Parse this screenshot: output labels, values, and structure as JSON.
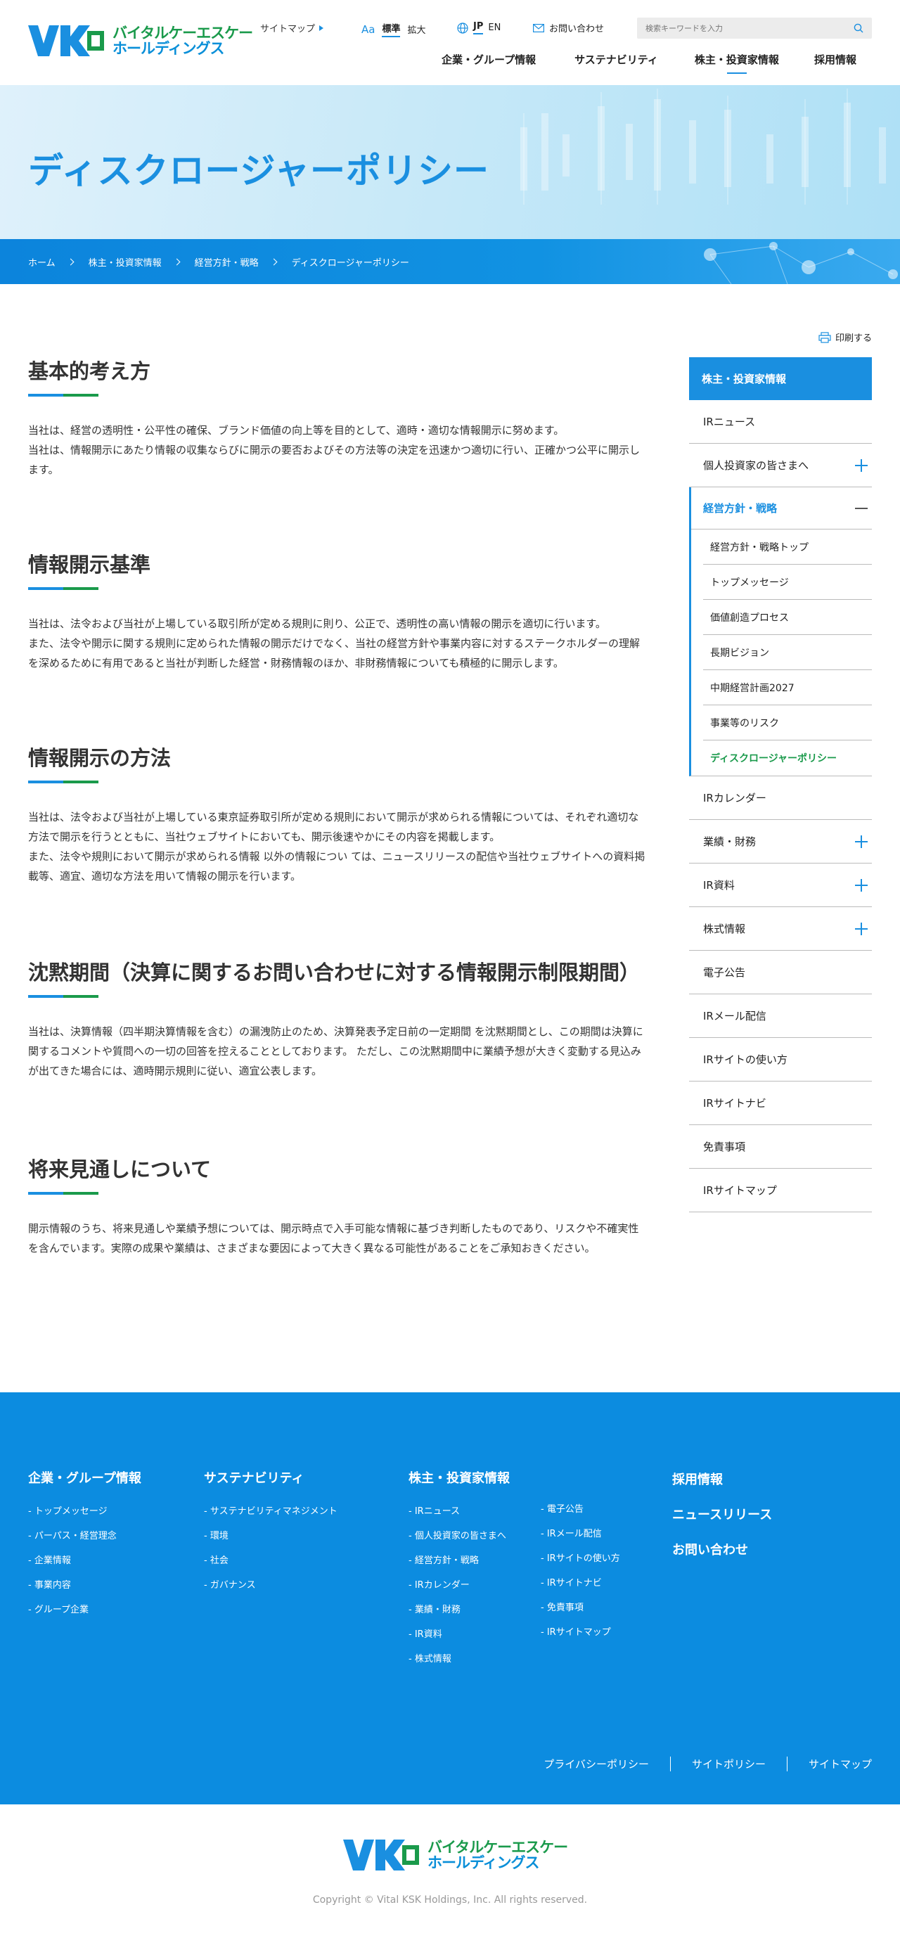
{
  "header": {
    "logo_line1": "バイタルケーエスケー",
    "logo_line2": "ホールディングス",
    "sitemap": "サイトマップ",
    "font_size_icon": "Aa",
    "font_standard": "標準",
    "font_large": "拡大",
    "lang_jp": "JP",
    "lang_en": "EN",
    "contact": "お問い合わせ",
    "search_placeholder": "検索キーワードを入力",
    "nav": [
      {
        "label": "企業・グループ情報"
      },
      {
        "label": "サステナビリティ"
      },
      {
        "label": "株主・投資家情報"
      },
      {
        "label": "採用情報"
      }
    ]
  },
  "hero": {
    "title": "ディスクロージャーポリシー"
  },
  "breadcrumb": [
    "ホーム",
    "株主・投資家情報",
    "経営方針・戦略",
    "ディスクロージャーポリシー"
  ],
  "print": "印刷する",
  "sections": [
    {
      "title": "基本的考え方",
      "body": "当社は、経営の透明性・公平性の確保、ブランド価値の向上等を目的として、適時・適切な情報開示に努めます。\n当社は、情報開示にあたり情報の収集ならびに開示の要否およびその方法等の決定を迅速かつ適切に行い、正確かつ公平に開示します。"
    },
    {
      "title": "情報開示基準",
      "body": "当社は、法令および当社が上場している取引所が定める規則に則り、公正で、透明性の高い情報の開示を適切に行います。\nまた、法令や開示に関する規則に定められた情報の開示だけでなく、当社の経営方針や事業内容に対するステークホルダーの理解を深めるために有用であると当社が判断した経営・財務情報のほか、非財務情報についても積極的に開示します。"
    },
    {
      "title": "情報開示の方法",
      "body": "当社は、法令および当社が上場している東京証券取引所が定める規則において開示が求められる情報については、それぞれ適切な方法で開示を行うとともに、当社ウェブサイトにおいても、開示後速やかにその内容を掲載します。\nまた、法令や規則において開示が求められる情報 以外の情報につい ては、ニュースリリースの配信や当社ウェブサイトへの資料掲載等、適宜、適切な方法を用いて情報の開示を行います。"
    },
    {
      "title": "沈黙期間（決算に関するお問い合わせに対する情報開示制限期間）",
      "body": "当社は、決算情報（四半期決算情報を含む）の漏洩防止のため、決算発表予定日前の一定期間 を沈黙期間とし、この期間は決算に関するコメントや質問への一切の回答を控えることとしております。 ただし、この沈黙期間中に業績予想が大きく変動する見込みが出てきた場合には、適時開示規則に従い、適宜公表します。"
    },
    {
      "title": "将来見通しについて",
      "body": "開示情報のうち、将来見通しや業績予想については、開示時点で入手可能な情報に基づき判断したものであり、リスクや不確実性を含んでいます。実際の成果や業績は、さまざまな要因によって大きく異なる可能性があることをご承知おきください。"
    }
  ],
  "sidebar": {
    "heading": "株主・投資家情報",
    "items_before": [
      {
        "label": "IRニュース",
        "expand": false
      },
      {
        "label": "個人投資家の皆さまへ",
        "expand": true
      }
    ],
    "group": {
      "label": "経営方針・戦略",
      "subs": [
        "経営方針・戦略トップ",
        "トップメッセージ",
        "価値創造プロセス",
        "長期ビジョン",
        "中期経営計画2027",
        "事業等のリスク",
        "ディスクロージャーポリシー"
      ]
    },
    "items_after": [
      {
        "label": "IRカレンダー",
        "expand": false
      },
      {
        "label": "業績・財務",
        "expand": true
      },
      {
        "label": "IR資料",
        "expand": true
      },
      {
        "label": "株式情報",
        "expand": true
      },
      {
        "label": "電子公告",
        "expand": false
      },
      {
        "label": "IRメール配信",
        "expand": false
      },
      {
        "label": "IRサイトの使い方",
        "expand": false
      },
      {
        "label": "IRサイトナビ",
        "expand": false
      },
      {
        "label": "免責事項",
        "expand": false
      },
      {
        "label": "IRサイトマップ",
        "expand": false
      }
    ]
  },
  "footer": {
    "corp": {
      "title": "企業・グループ情報",
      "links": [
        "トップメッセージ",
        "パーパス・経営理念",
        "企業情報",
        "事業内容",
        "グループ企業"
      ]
    },
    "sus": {
      "title": "サステナビリティ",
      "links": [
        "サステナビリティマネジメント",
        "環境",
        "社会",
        "ガバナンス"
      ]
    },
    "ir": {
      "title": "株主・投資家情報",
      "links_a": [
        "IRニュース",
        "個人投資家の皆さまへ",
        "経営方針・戦略",
        "IRカレンダー",
        "業績・財務",
        "IR資料",
        "株式情報"
      ],
      "links_b": [
        "電子公告",
        "IRメール配信",
        "IRサイトの使い方",
        "IRサイトナビ",
        "免責事項",
        "IRサイトマップ"
      ]
    },
    "main_links": [
      "採用情報",
      "ニュースリリース",
      "お問い合わせ"
    ],
    "bottom_links": [
      "プライバシーポリシー",
      "サイトポリシー",
      "サイトマップ"
    ]
  },
  "copyright": "Copyright © Vital KSK Holdings, Inc. All rights reserved.",
  "colors": {
    "primary": "#1a8fe0",
    "accent_green": "#1a9a4b",
    "footer_bg": "#0c8ce0"
  }
}
